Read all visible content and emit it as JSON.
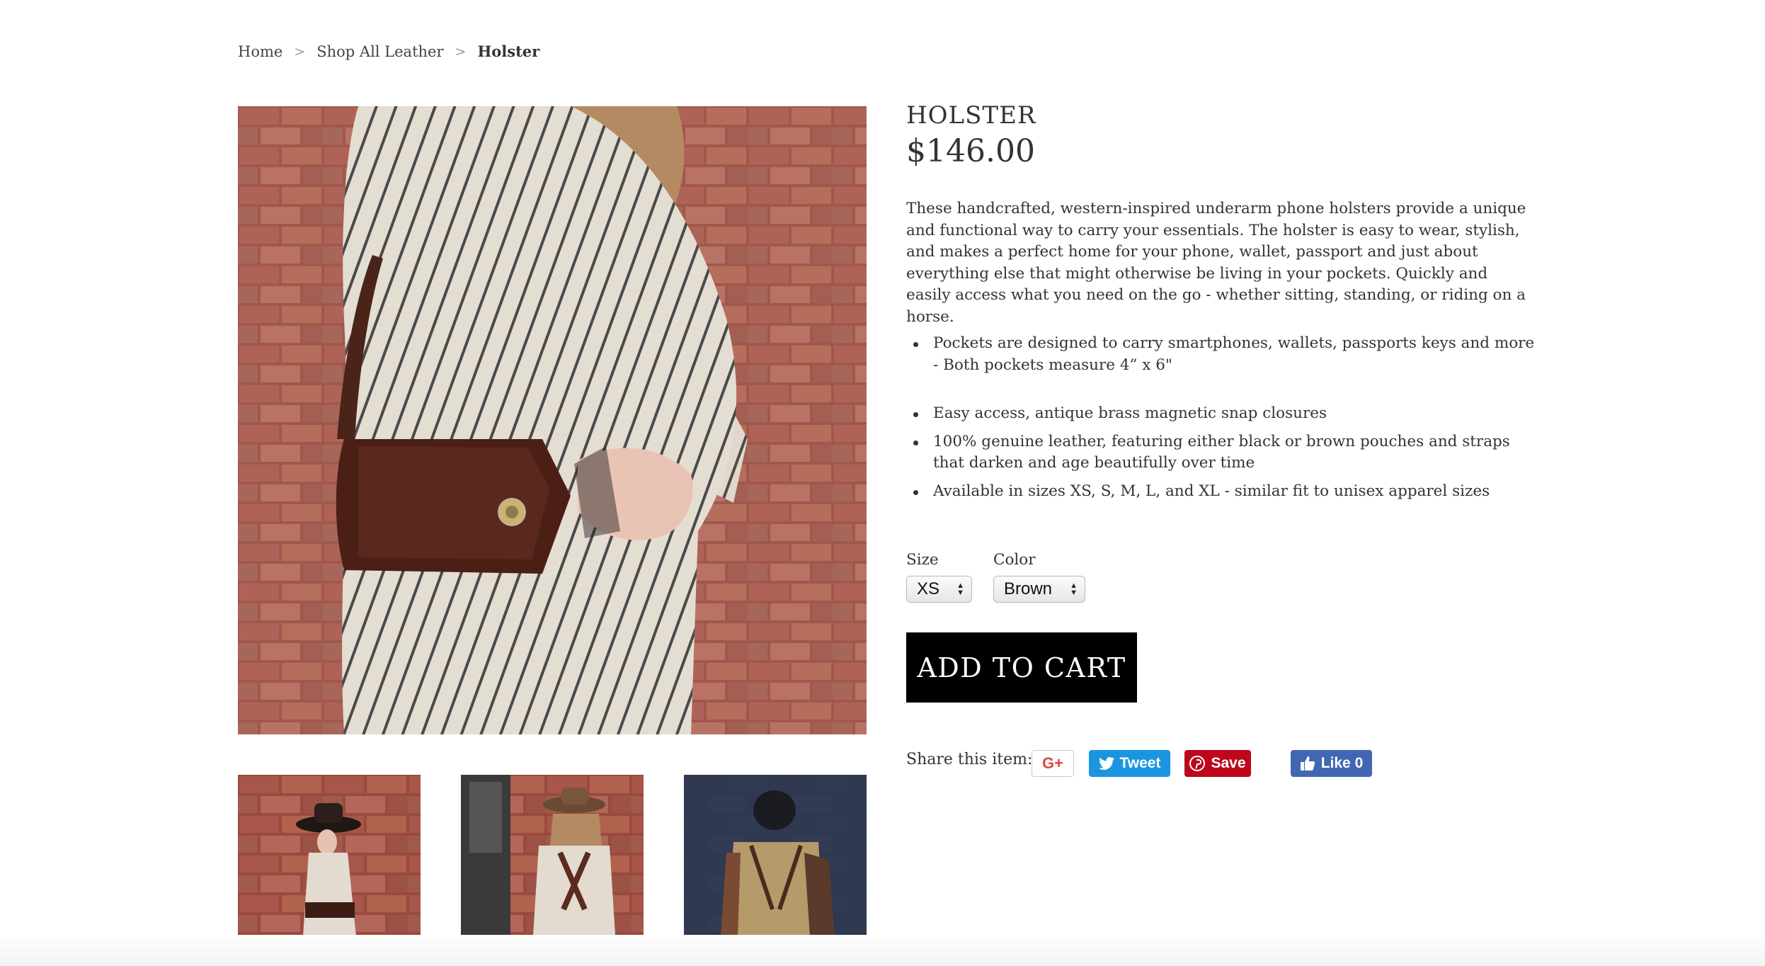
{
  "breadcrumb": {
    "home": "Home",
    "separator": ">",
    "category": "Shop All Leather",
    "current": "Holster"
  },
  "product": {
    "title": "HOLSTER",
    "price": "$146.00",
    "description": "These handcrafted, western-inspired underarm phone holsters provide a unique and functional way to carry your essentials. The holster is easy to wear, stylish, and makes a perfect home for your phone, wallet, passport and just about everything else that might otherwise be living in your pockets. Quickly and easily access what you need on the go - whether sitting, standing, or riding on a horse.",
    "features": [
      "Pockets are designed to carry smartphones, wallets, passports keys and more - Both pockets measure 4” x 6\"",
      "Easy access, antique brass magnetic snap closures",
      "100% genuine leather, featuring either black or brown pouches and straps that darken and age beautifully over time",
      "Available in sizes XS, S, M, L, and XL - similar fit to unisex apparel sizes"
    ]
  },
  "options": {
    "size_label": "Size",
    "size_value": "XS",
    "color_label": "Color",
    "color_value": "Brown"
  },
  "cart": {
    "add_label": "ADD TO CART"
  },
  "share": {
    "label": "Share this item:",
    "gplus_label": "G+",
    "tweet_label": "Tweet",
    "pin_label": "Save",
    "fb_label": "Like 0"
  },
  "images": {
    "main": "woman-striped-coat-brown-holster-brick-wall",
    "thumbs": [
      "woman-hat-brick-wall",
      "woman-back-view-holster",
      "man-beanie-blue-wall"
    ]
  },
  "colors": {
    "tweet": "#1b95e0",
    "pinterest": "#bd081c",
    "facebook": "#4267b2",
    "cart": "#000000"
  }
}
